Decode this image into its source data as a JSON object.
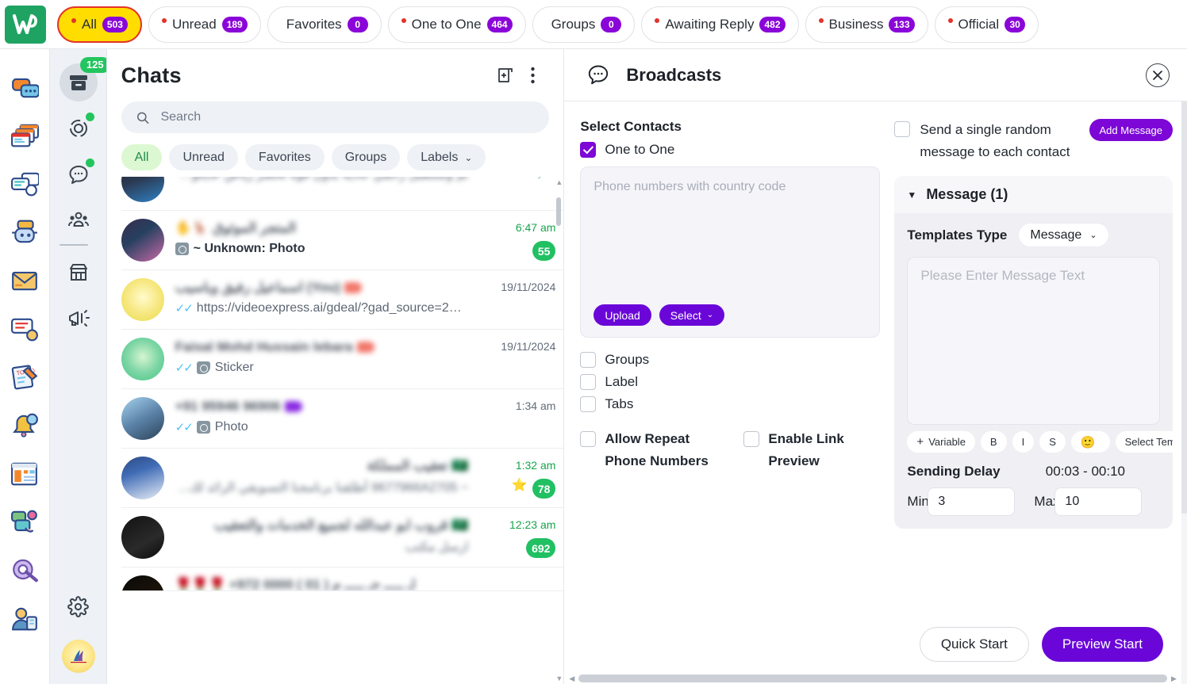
{
  "topbar": {
    "brand_icon": "whatsapp-w-logo",
    "tabs": [
      {
        "label": "All",
        "count": "503",
        "active": true,
        "dot": true
      },
      {
        "label": "Unread",
        "count": "189",
        "active": false,
        "dot": true
      },
      {
        "label": "Favorites",
        "count": "0",
        "active": false,
        "dot": false
      },
      {
        "label": "One to One",
        "count": "464",
        "active": false,
        "dot": true
      },
      {
        "label": "Groups",
        "count": "0",
        "active": false,
        "dot": false
      },
      {
        "label": "Awaiting Reply",
        "count": "482",
        "active": false,
        "dot": true
      },
      {
        "label": "Business",
        "count": "133",
        "active": false,
        "dot": true
      },
      {
        "label": "Official",
        "count": "30",
        "active": false,
        "dot": true
      }
    ]
  },
  "rail_primary": {
    "items": [
      {
        "icon": "chat-bubbles-icon"
      },
      {
        "icon": "windows-stack-icon"
      },
      {
        "icon": "message-group-icon"
      },
      {
        "icon": "chatbot-icon"
      },
      {
        "icon": "envelope-icon"
      },
      {
        "icon": "message-bell-icon"
      },
      {
        "icon": "todo-list-icon"
      },
      {
        "icon": "bell-clock-icon"
      },
      {
        "icon": "dashboard-icon"
      },
      {
        "icon": "click-bubbles-icon"
      },
      {
        "icon": "gear-wrench-icon"
      },
      {
        "icon": "agent-support-icon"
      }
    ]
  },
  "rail_secondary": {
    "items": [
      {
        "icon": "archive-chats-icon",
        "badge": "125",
        "selected": true
      },
      {
        "icon": "status-ring-icon",
        "dot": true
      },
      {
        "icon": "chat-dots-icon",
        "dot": true
      },
      {
        "icon": "community-icon"
      },
      {
        "icon": "store-icon"
      },
      {
        "icon": "megaphone-icon"
      }
    ],
    "gear_icon": "settings-gear-icon",
    "avatar_icon": "user-avatar"
  },
  "chats": {
    "title": "Chats",
    "new_chat_icon": "new-chat-plus-icon",
    "menu_icon": "more-vertical-icon",
    "search": {
      "placeholder": "Search",
      "value": "",
      "icon": "search-icon"
    },
    "filters": [
      {
        "label": "All",
        "active": true
      },
      {
        "label": "Unread",
        "active": false
      },
      {
        "label": "Favorites",
        "active": false
      },
      {
        "label": "Groups",
        "active": false
      },
      {
        "label": "Labels",
        "active": false,
        "caret": true
      }
    ],
    "rows": [
      {
        "name": "",
        "preview": "تم وستنقبل رحمي عاديه بدون قوة  لحضر رياض  عايكون نظا...",
        "preview_rtl": true,
        "time": "",
        "pinned": true,
        "partial": true,
        "avatar": "linear-gradient(160deg,#1d2430 0%,#2b3a52 45%,#2f81c4 100%)"
      },
      {
        "name": "المتجر الموثوق",
        "name_emoji": "✋🦌",
        "preview": "~ Unknown:  Photo",
        "preview_bold": true,
        "preview_icon": "photo-icon",
        "time": "6:47 am",
        "time_green": true,
        "badge": "55",
        "avatar": "linear-gradient(145deg,#3b2c50 0%,#26405f 40%,#c96aa8 100%)"
      },
      {
        "name": "اسماعيل رفيق وباسيب (You)",
        "tag_color": "#f2776b",
        "preview": "https://videoexpress.ai/gdeal/?gad_source=2&gclid=C...",
        "ticks": true,
        "time": "19/11/2024",
        "avatar": "radial-gradient(circle at 50% 45%,#fffbcc 0%,#f6e67c 55%,#e6dd4a 100%)"
      },
      {
        "name": "Faisal Mohd Hussain lebara",
        "tag_color": "#f2776b",
        "preview": "Sticker",
        "preview_icon": "sticker-icon",
        "ticks": true,
        "time": "19/11/2024",
        "avatar": "radial-gradient(circle at 50% 45%,#d6f5cf 0%,#7fd6a6 50%,#40c785 100%)"
      },
      {
        "name": "+91 95946 96906",
        "tag_color": "#8a2be2",
        "preview": "Photo",
        "preview_icon": "photo-icon",
        "ticks": true,
        "time": "1:34 am",
        "avatar": "linear-gradient(150deg,#a8d3ef 0%,#5b83a8 50%,#2c4159 100%)"
      },
      {
        "name": "تعقيب المملكة",
        "flag": "🇸🇦",
        "preview": "~ 9677966A2705        أطلقنا برنامجنا التسويقي الرائد لك...",
        "preview_rtl": true,
        "star": "⭐",
        "time": "1:32 am",
        "time_green": true,
        "badge": "78",
        "avatar": "linear-gradient(160deg,#2e4a84 0%,#3f6bb5 35%,#e8eef6 100%)"
      },
      {
        "name": "قروب ابو عبدالله لجميع الخدمات والتعقيب",
        "flag": "🇸🇦",
        "preview": "ارسل مكتب",
        "preview_rtl": true,
        "time": "12:23 am",
        "time_green": true,
        "badge": "692",
        "avatar": "linear-gradient(150deg,#121212 0%,#2a2a2a 60%,#0b0b0b 100%)"
      },
      {
        "name": "🌹🌹🌹 +972 0000 ( 01 ) لـ ـــــ حـ ـــــ م",
        "time": "",
        "partial_bottom": true,
        "avatar": "linear-gradient(150deg,#0a0a0a 0%,#1c1408 60%,#000 100%)"
      }
    ]
  },
  "broadcasts": {
    "title": "Broadcasts",
    "header_icon": "broadcast-bubble-icon",
    "close_icon": "close-icon",
    "select_contacts_label": "Select Contacts",
    "one_to_one": {
      "label": "One to One",
      "checked": true
    },
    "phone_textarea": {
      "placeholder": "Phone numbers with country code",
      "value": ""
    },
    "upload_button": "Upload",
    "select_button": "Select",
    "options": [
      {
        "label": "Groups",
        "checked": false
      },
      {
        "label": "Label",
        "checked": false
      },
      {
        "label": "Tabs",
        "checked": false
      }
    ],
    "bottom_options": [
      {
        "label": "Allow Repeat Phone Numbers",
        "checked": false
      },
      {
        "label": "Enable Link Preview",
        "checked": false
      }
    ],
    "random_message": {
      "label": "Send a single random message to each contact",
      "checked": false
    },
    "add_message_button": "Add Message",
    "message_card": {
      "title": "Message (1)",
      "expanded": true,
      "templates_type_label": "Templates Type",
      "templates_type_value": "Message",
      "message_placeholder": "Please Enter Message Text",
      "message_value": "",
      "tools": [
        {
          "label": "Variable",
          "icon": "plus-icon"
        },
        {
          "label": "B"
        },
        {
          "label": "I"
        },
        {
          "label": "S"
        },
        {
          "label": "",
          "icon": "emoji-icon"
        },
        {
          "label": "Select Tem"
        }
      ],
      "sending_delay_label": "Sending Delay",
      "sending_delay_value": "00:03 - 00:10",
      "min_label": "Min",
      "min_value": "3",
      "max_label": "Max",
      "max_value": "10"
    },
    "quick_start_button": "Quick Start",
    "preview_start_button": "Preview Start"
  },
  "colors": {
    "brand_green": "#1ea362",
    "accent_purple": "#7c07d6",
    "badge_purple": "#8a06d8",
    "tab_active_bg": "#ffdd00",
    "tab_active_border": "#e4332a",
    "unread_green": "#21c063",
    "chip_active_bg": "#dcf8d2"
  }
}
